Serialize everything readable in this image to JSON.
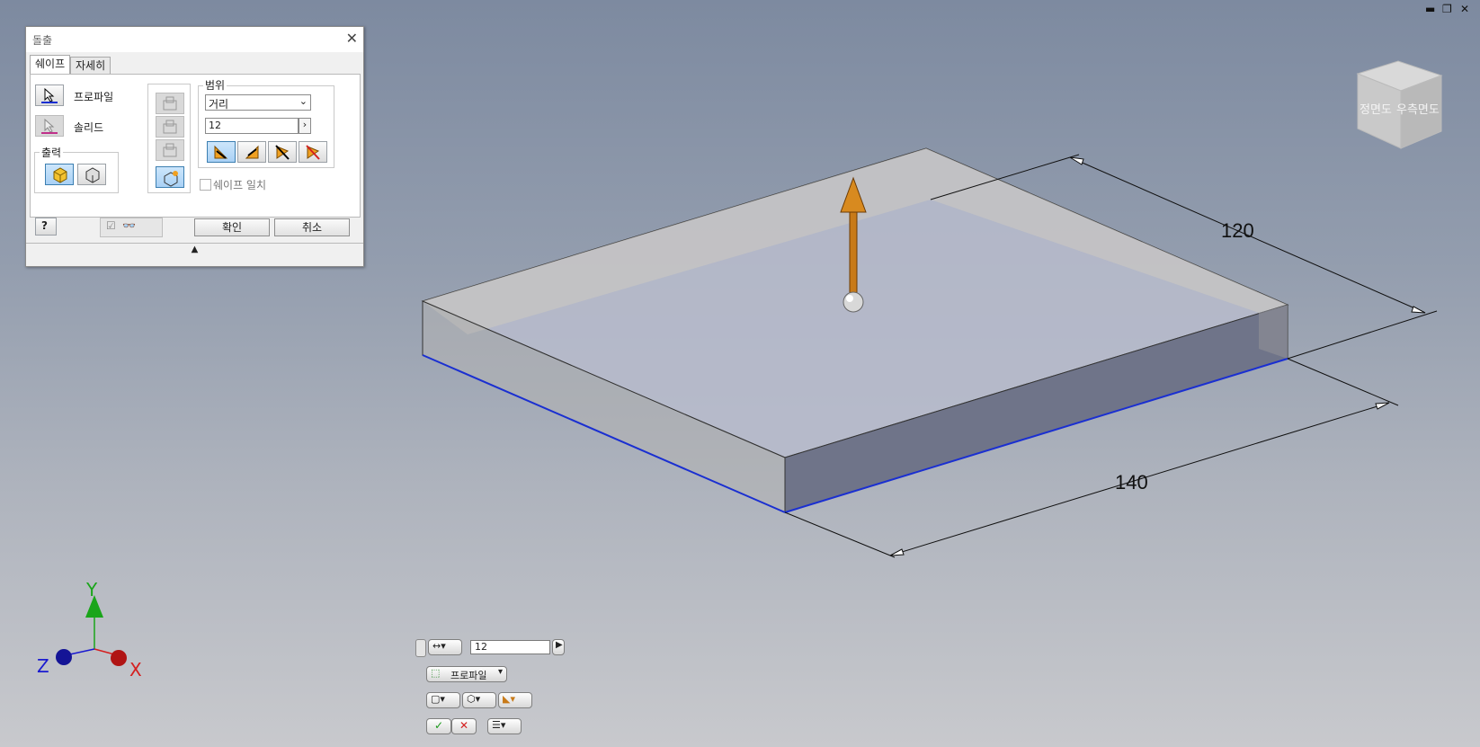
{
  "dialog": {
    "title": "돌출",
    "tabs": [
      "쉐이프",
      "자세히"
    ],
    "profile_label": "프로파일",
    "solid_label": "솔리드",
    "output_label": "출력",
    "extents_label": "범위",
    "extents_type": "거리",
    "distance_value": "12",
    "match_shape_label": "쉐이프 일치",
    "ok_label": "확인",
    "cancel_label": "취소",
    "collapse_glyph": "▲"
  },
  "viewcube": {
    "front_label": "정면도",
    "right_label": "우측면도"
  },
  "dimensions": {
    "depth_label": "120",
    "width_label": "140"
  },
  "triad": {
    "x": "X",
    "y": "Y",
    "z": "Z"
  },
  "minitoolbar": {
    "distance_value": "12",
    "profile_label": "프로파일"
  },
  "window_controls": {
    "minimize": "▬",
    "restore": "❐",
    "close": "✕"
  },
  "colors": {
    "profile_edge": "#1a2fd1",
    "arrow": "#c87a18",
    "x_axis": "#d42020",
    "y_axis": "#1aa51a",
    "z_axis": "#1a1ad0",
    "dim_text": "#111111"
  }
}
